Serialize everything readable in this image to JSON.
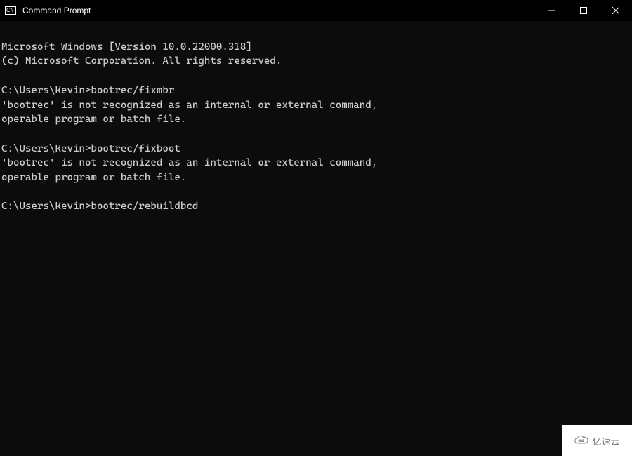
{
  "window": {
    "title": "Command Prompt"
  },
  "terminal": {
    "lines": [
      "Microsoft Windows [Version 10.0.22000.318]",
      "(c) Microsoft Corporation. All rights reserved.",
      "",
      "C:\\Users\\Kevin>bootrec/fixmbr",
      "'bootrec' is not recognized as an internal or external command,",
      "operable program or batch file.",
      "",
      "C:\\Users\\Kevin>bootrec/fixboot",
      "'bootrec' is not recognized as an internal or external command,",
      "operable program or batch file.",
      "",
      "C:\\Users\\Kevin>bootrec/rebuildbcd"
    ]
  },
  "watermark": {
    "label": "亿速云"
  }
}
